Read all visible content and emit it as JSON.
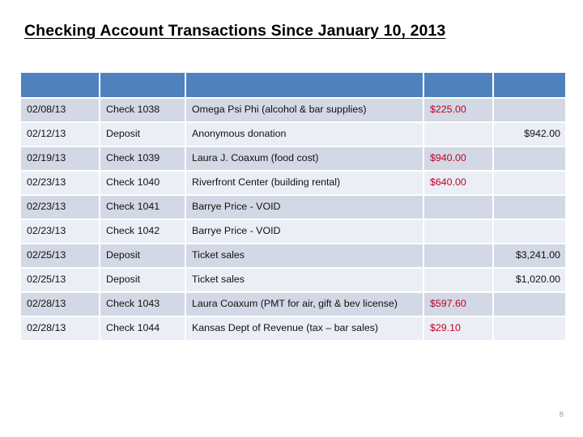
{
  "slide": {
    "title": "Checking Account Transactions Since January 10, 2013",
    "page_number": "8"
  },
  "theme": {
    "header_blue": "#4F81BD",
    "row_odd": "#D2D8E4",
    "row_even": "#EBEEF5",
    "debit_red": "#C00026",
    "text_black": "#111111",
    "page_number_gray": "#9AA0A6"
  },
  "table": {
    "columns": [
      {
        "key": "date",
        "label": ""
      },
      {
        "key": "type",
        "label": ""
      },
      {
        "key": "description",
        "label": ""
      },
      {
        "key": "withdrawal",
        "label": ""
      },
      {
        "key": "deposit",
        "label": ""
      }
    ],
    "rows": [
      {
        "date": "02/08/13",
        "type": "Check 1038",
        "description": "Omega Psi Phi (alcohol & bar supplies)",
        "withdrawal": "$225.00",
        "deposit": ""
      },
      {
        "date": "02/12/13",
        "type": "Deposit",
        "description": "Anonymous donation",
        "withdrawal": "",
        "deposit": "$942.00"
      },
      {
        "date": "02/19/13",
        "type": "Check 1039",
        "description": "Laura J. Coaxum (food cost)",
        "withdrawal": "$940.00",
        "deposit": ""
      },
      {
        "date": "02/23/13",
        "type": "Check 1040",
        "description": "Riverfront Center (building rental)",
        "withdrawal": "$640.00",
        "deposit": ""
      },
      {
        "date": "02/23/13",
        "type": "Check 1041",
        "description": "Barrye Price  - VOID",
        "withdrawal": "",
        "deposit": ""
      },
      {
        "date": "02/23/13",
        "type": "Check 1042",
        "description": "Barrye Price  - VOID",
        "withdrawal": "",
        "deposit": ""
      },
      {
        "date": "02/25/13",
        "type": "Deposit",
        "description": "Ticket sales",
        "withdrawal": "",
        "deposit": "$3,241.00"
      },
      {
        "date": "02/25/13",
        "type": "Deposit",
        "description": "Ticket sales",
        "withdrawal": "",
        "deposit": "$1,020.00"
      },
      {
        "date": "02/28/13",
        "type": "Check 1043",
        "description": "Laura Coaxum (PMT for air, gift & bev license)",
        "withdrawal": "$597.60",
        "deposit": ""
      },
      {
        "date": "02/28/13",
        "type": "Check 1044",
        "description": "Kansas Dept of Revenue (tax – bar sales)",
        "withdrawal": "$29.10",
        "deposit": ""
      }
    ]
  }
}
